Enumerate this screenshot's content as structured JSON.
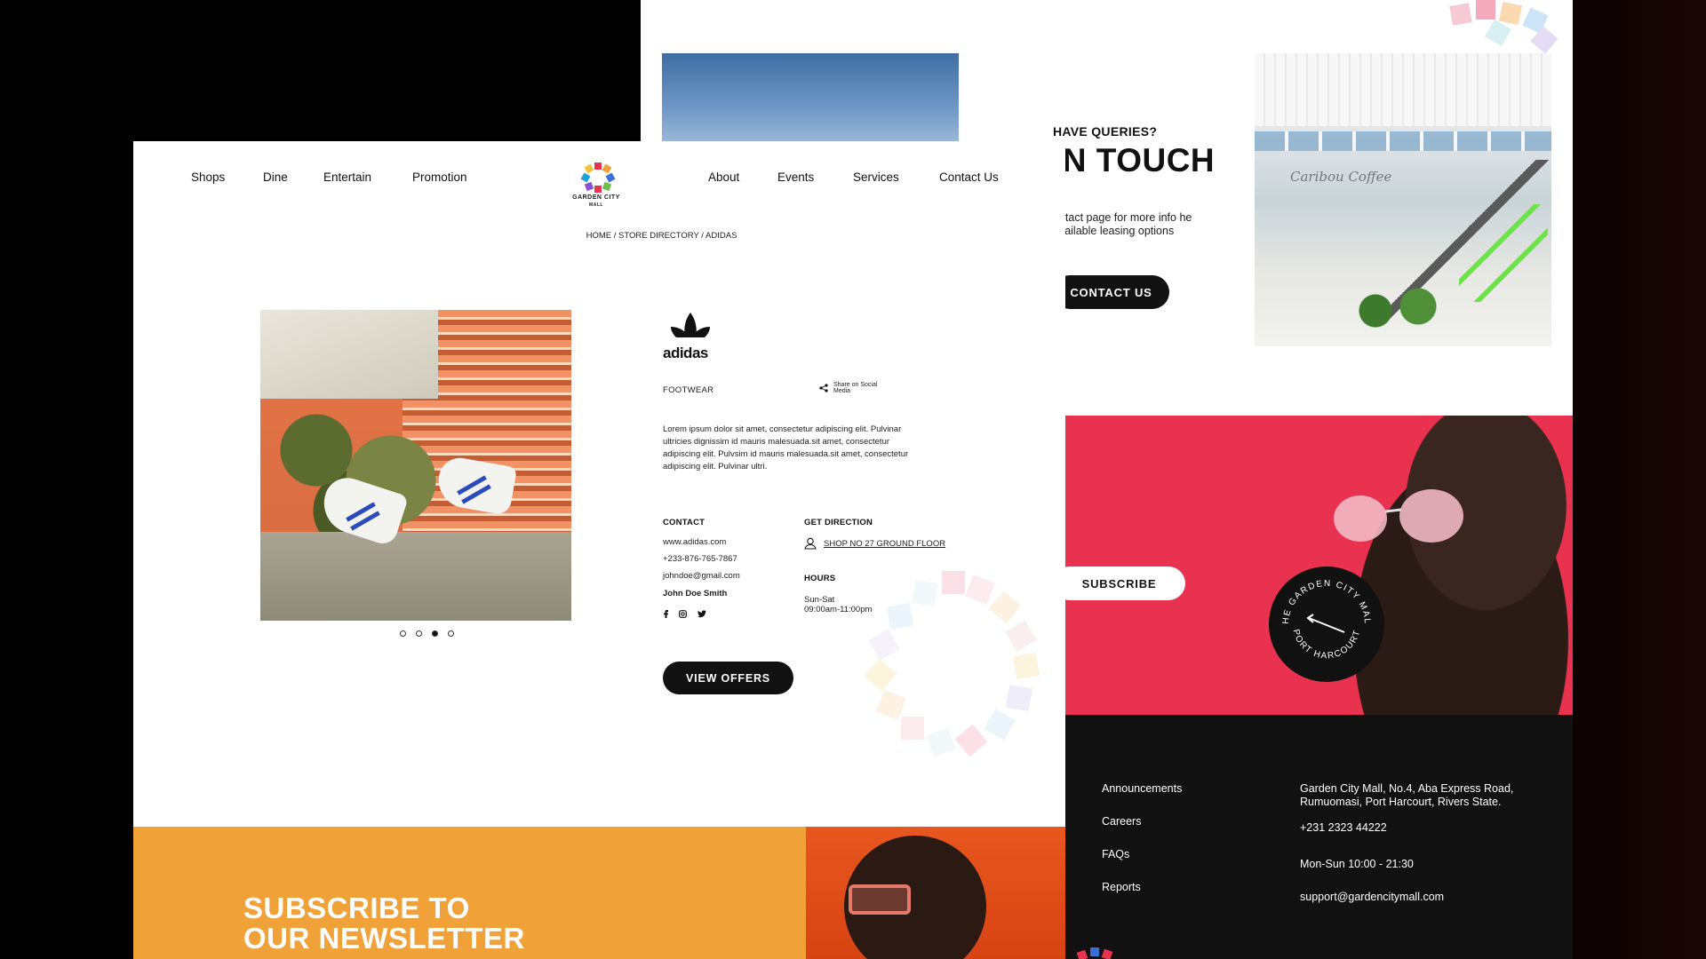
{
  "back_page": {
    "queries_label": "HAVE QUERIES?",
    "headline": "IN TOUCH",
    "contact_text": "ontact page for more info he available leasing options",
    "contact_button": "CONTACT US",
    "coffee_sign": "Caribou Coffee",
    "subscribe_button": "SUBSCRIBE",
    "seal_text_top": "THE GARDEN CITY MALL",
    "seal_text_bottom": "PORT HARCOURT",
    "footer_links": [
      "Announcements",
      "Careers",
      "FAQs",
      "Reports"
    ],
    "address": "Garden City Mall, No.4, Aba Express Road, Rumuomasi, Port Harcourt, Rivers State.",
    "phone": "+231 2323 44222",
    "opening_hours": "Mon-Sun 10:00 - 21:30",
    "email": "support@gardencitymall.com"
  },
  "nav": {
    "left": [
      "Shops",
      "Dine",
      "Entertain",
      "Promotion"
    ],
    "right": [
      "About",
      "Events",
      "Services",
      "Contact Us"
    ],
    "logo_text_line1": "GARDEN CITY",
    "logo_text_line2": "MALL"
  },
  "breadcrumb": "HOME / STORE DIRECTORY / ADIDAS",
  "store": {
    "brand": "adidas",
    "category": "FOOTWEAR",
    "share_label": "Share on Social Media",
    "description": "Lorem ipsum dolor sit amet, consectetur adipiscing elit. Pulvinar ultricies dignissim id mauris malesuada.sit amet, consectetur adipiscing elit. Pulvsim id mauris malesuada.sit amet, consectetur adipiscing elit. Pulvinar ultri.",
    "contact_heading": "CONTACT",
    "website": "www.adidas.com",
    "phone": "+233-876-765-7867",
    "email": "johndoe@gmail.com",
    "contact_name": "John Doe Smith",
    "direction_heading": "GET DIRECTION",
    "location": "SHOP NO 27 GROUND FLOOR",
    "hours_heading": "HOURS",
    "days": "Sun-Sat",
    "hours": "09:00am-11:00pm",
    "offers_button": "VIEW OFFERS",
    "carousel": {
      "count": 4,
      "active": 3
    }
  },
  "newsletter": {
    "line1": "SUBSCRIBE TO",
    "line2": "OUR NEWSLETTER"
  },
  "colors": {
    "pink_band": "#e8324f",
    "orange_band": "#f0a137",
    "dark": "#111111"
  }
}
